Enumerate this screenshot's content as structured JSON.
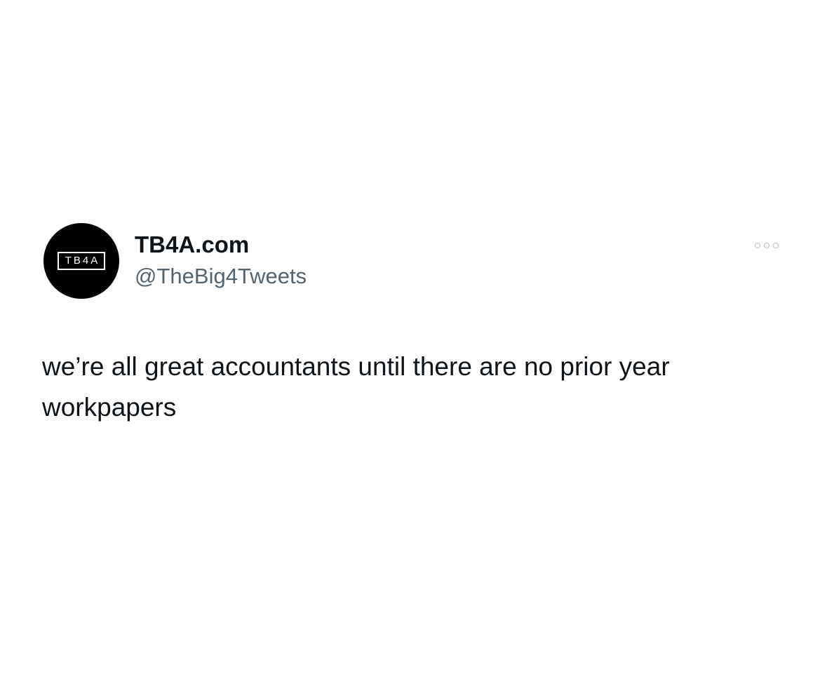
{
  "tweet": {
    "avatar": {
      "icon": "tb4a-logo-icon",
      "logo_text": "TB4A",
      "background": "#000000",
      "foreground": "#ffffff"
    },
    "display_name": "TB4A.com",
    "handle": "@TheBig4Tweets",
    "more_icon": "more-horizontal-icon",
    "text": "we’re all great accountants until there are no prior year\nworkpapers"
  },
  "colors": {
    "text_primary": "#0f1419",
    "text_secondary": "#536471",
    "background": "#ffffff"
  }
}
